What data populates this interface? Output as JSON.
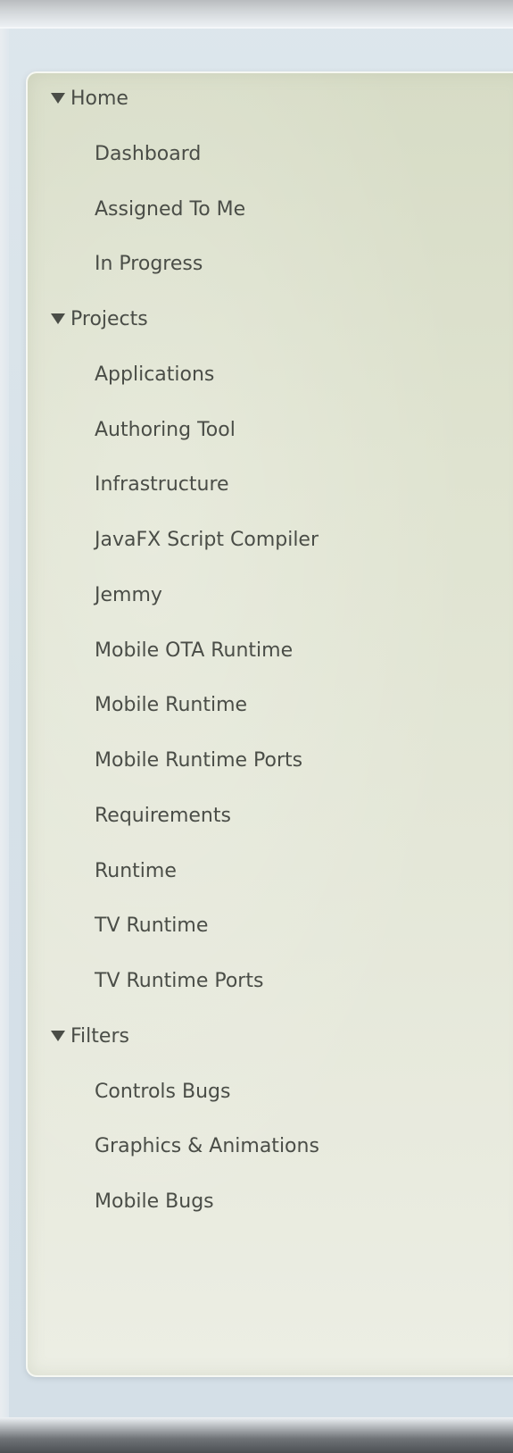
{
  "sidebar": {
    "sections": [
      {
        "label": "Home",
        "expanded": true,
        "icon": "triangle-down-icon",
        "items": [
          "Dashboard",
          "Assigned To Me",
          "In Progress"
        ]
      },
      {
        "label": "Projects",
        "expanded": true,
        "icon": "triangle-down-icon",
        "items": [
          "Applications",
          "Authoring Tool",
          "Infrastructure",
          "JavaFX Script Compiler",
          "Jemmy",
          "Mobile OTA Runtime",
          "Mobile Runtime",
          "Mobile Runtime Ports",
          "Requirements",
          "Runtime",
          "TV Runtime",
          "TV Runtime Ports"
        ]
      },
      {
        "label": "Filters",
        "expanded": true,
        "icon": "triangle-down-icon",
        "items": [
          "Controls Bugs",
          "Graphics & Animations",
          "Mobile Bugs"
        ]
      }
    ]
  },
  "colors": {
    "panel_background": "#e4e7d8",
    "text": "#4a4d47",
    "page_background": "#d8e3ea"
  }
}
